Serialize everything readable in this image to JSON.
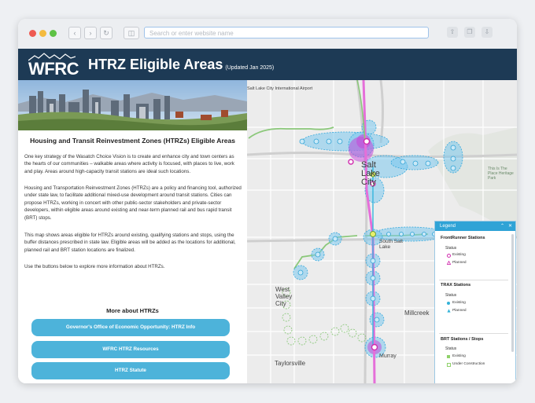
{
  "browser": {
    "url_placeholder": "Search or enter website name"
  },
  "header": {
    "logo_text": "WFRC",
    "title": "HTRZ Eligible Areas",
    "updated": "(Updated Jan 2025)"
  },
  "panel": {
    "heading": "Housing and Transit Reinvestment Zones (HTRZs) Eligible Areas",
    "paragraphs": [
      "One key strategy of the Wasatch Choice Vision is to create and enhance city and town centers as the hearts of our communities – walkable areas where activity is focused, with places to live, work and play. Areas around high-capacity transit stations are ideal such locations.",
      "Housing and Transportation Reinvestment Zones (HTRZs) are a policy and financing tool, authorized under state law, to facilitate additional mixed-use development around transit stations. Cities can propose HTRZs, working in concert with other public-sector stakeholders and private-sector developers, within eligible areas around existing and near-term planned rail and bus rapid transit (BRT) stops.",
      "This map shows areas eligible for HTRZs around existing, qualifying stations and stops, using the buffer distances prescribed in state law. Eligible areas will be added as the locations for additional, planned rail and BRT station locations are finalized.",
      "Use the buttons below to explore more information about HTRZs."
    ],
    "more_heading": "More about HTRZs",
    "buttons": [
      "Governor's Office of Economic Opportunity: HTRZ Info",
      "WFRC HTRZ Resources",
      "HTRZ Statute"
    ]
  },
  "map": {
    "labels": {
      "airport": "Salt Lake City International Airport",
      "salt_lake_city": "Salt Lake City",
      "south_salt_lake": "South Salt Lake",
      "west_valley_city": "West Valley City",
      "millcreek": "Millcreek",
      "taylorsville": "Taylorsville",
      "murray": "Murray",
      "this_is_the_place": "This Is The Place Heritage Park"
    }
  },
  "legend": {
    "title": "Legend",
    "sections": [
      {
        "title": "FrontRunner Stations",
        "status": "Status",
        "items": [
          "Existing",
          "Planned"
        ]
      },
      {
        "title": "TRAX Stations",
        "status": "Status",
        "items": [
          "Existing",
          "Planned"
        ]
      },
      {
        "title": "BRT Stations / Stops",
        "status": "Status",
        "items": [
          "Existing",
          "Under Construction"
        ]
      }
    ]
  },
  "colors": {
    "header_bg": "#1d3a55",
    "button_bg": "#4db3da",
    "buffer_fill": "#7cc8ee",
    "frontrunner": "#d946c8",
    "trax": "#33b2d8",
    "brt": "#8fd16a"
  }
}
